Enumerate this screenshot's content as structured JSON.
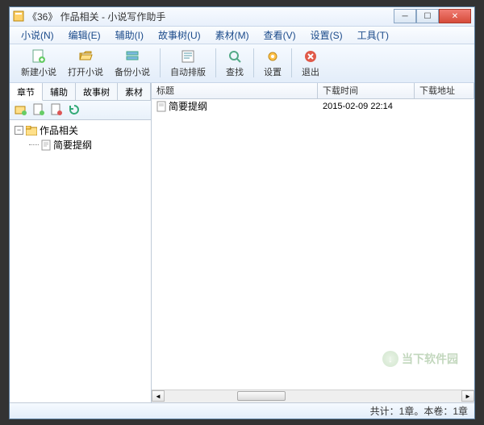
{
  "title": "《36》 作品相关 - 小说写作助手",
  "menus": [
    {
      "label": "小说(N)"
    },
    {
      "label": "编辑(E)"
    },
    {
      "label": "辅助(I)"
    },
    {
      "label": "故事树(U)"
    },
    {
      "label": "素材(M)"
    },
    {
      "label": "查看(V)"
    },
    {
      "label": "设置(S)"
    },
    {
      "label": "工具(T)"
    }
  ],
  "toolbar": {
    "new_novel": "新建小说",
    "open_novel": "打开小说",
    "backup_novel": "备份小说",
    "auto_typeset": "自动排版",
    "find": "查找",
    "settings": "设置",
    "exit": "退出"
  },
  "left_tabs": [
    {
      "label": "章节",
      "active": true
    },
    {
      "label": "辅助"
    },
    {
      "label": "故事树"
    },
    {
      "label": "素材"
    }
  ],
  "tree": {
    "root_label": "作品相关",
    "child_label": "简要提纲"
  },
  "list_columns": {
    "title": "标题",
    "dl_time": "下载时间",
    "dl_addr": "下载地址"
  },
  "list_columns_widths": {
    "title": 206,
    "dl_time": 120,
    "dl_addr": 80
  },
  "rows": [
    {
      "title": "简要提纲",
      "dl_time": "2015-02-09 22:14",
      "dl_addr": ""
    }
  ],
  "status": "共计：1章。本卷：1章",
  "watermark": "当下软件园"
}
